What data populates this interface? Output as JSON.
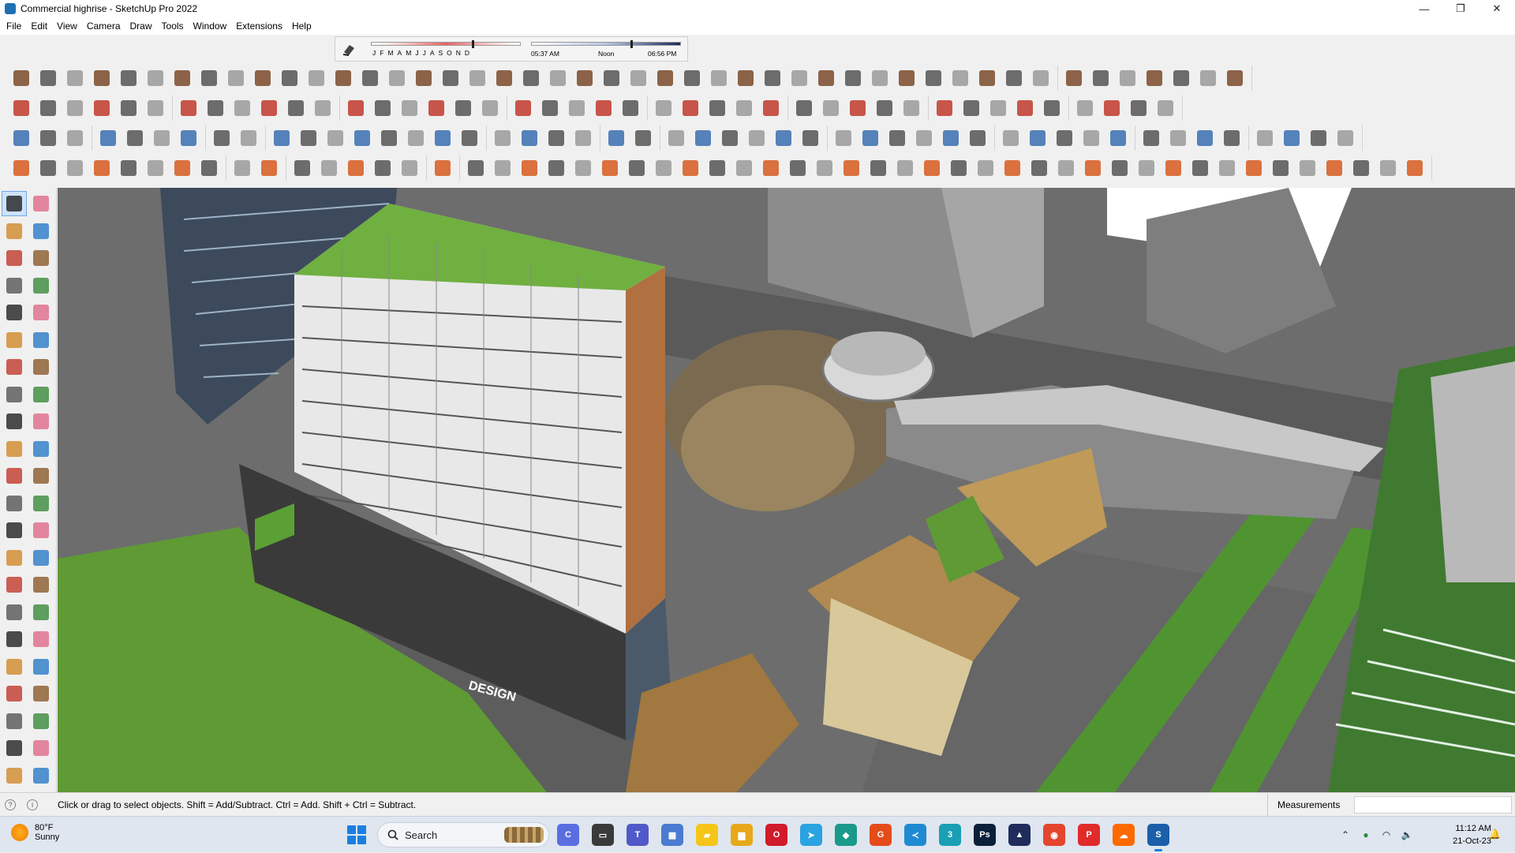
{
  "window": {
    "title": "Commercial highrise - SketchUp Pro 2022"
  },
  "window_controls": {
    "minimize": "—",
    "maximize": "❐",
    "close": "✕"
  },
  "menu": [
    "File",
    "Edit",
    "View",
    "Camera",
    "Draw",
    "Tools",
    "Window",
    "Extensions",
    "Help"
  ],
  "shadows": {
    "months": [
      "J",
      "F",
      "M",
      "A",
      "M",
      "J",
      "J",
      "A",
      "S",
      "O",
      "N",
      "D"
    ],
    "time_start": "05:37 AM",
    "time_mid": "Noon",
    "time_end": "06:56 PM"
  },
  "toolbar_icons": {
    "row1_color": "#7a4a2a",
    "row2_color": "#c0392b",
    "row3_color": "#3a6fb0",
    "row4_color": "#d65a1e"
  },
  "viewport": {
    "description_free": true,
    "signage": "DESIGN"
  },
  "status": {
    "message": "Click or drag to select objects. Shift = Add/Subtract. Ctrl = Add. Shift + Ctrl = Subtract.",
    "measurements_label": "Measurements",
    "measurements_value": ""
  },
  "taskbar": {
    "weather_temp": "80°F",
    "weather_condition": "Sunny",
    "search_label": "Search",
    "apps": [
      {
        "name": "copilot",
        "color": "#5b6ee1",
        "glyph": "C"
      },
      {
        "name": "task-view",
        "color": "#3a3a3a",
        "glyph": "▭"
      },
      {
        "name": "teams",
        "color": "#5059c9",
        "glyph": "T"
      },
      {
        "name": "calculator",
        "color": "#4a7bd0",
        "glyph": "▦"
      },
      {
        "name": "sticky-notes",
        "color": "#f5c518",
        "glyph": "▰"
      },
      {
        "name": "file-explorer",
        "color": "#e7a91b",
        "glyph": "▆"
      },
      {
        "name": "opera",
        "color": "#d11a2a",
        "glyph": "O"
      },
      {
        "name": "telegram",
        "color": "#2aa3e0",
        "glyph": "➤"
      },
      {
        "name": "maps-app",
        "color": "#1a9a8a",
        "glyph": "◆"
      },
      {
        "name": "grammarly",
        "color": "#e54b1b",
        "glyph": "G"
      },
      {
        "name": "vs-code",
        "color": "#1f8ad2",
        "glyph": "≺"
      },
      {
        "name": "sketchup-3",
        "color": "#1a9fb5",
        "glyph": "3"
      },
      {
        "name": "photoshop",
        "color": "#0b1f3a",
        "glyph": "Ps"
      },
      {
        "name": "vectorworks",
        "color": "#1f2c5c",
        "glyph": "▲"
      },
      {
        "name": "chrome",
        "color": "#e4452f",
        "glyph": "◉"
      },
      {
        "name": "pinterest",
        "color": "#e12a2a",
        "glyph": "P"
      },
      {
        "name": "soundcloud",
        "color": "#ff6a00",
        "glyph": "☁"
      },
      {
        "name": "sketchup",
        "color": "#1a5fa8",
        "glyph": "S"
      }
    ],
    "time": "11:12 AM",
    "date": "21-Oct-23"
  }
}
